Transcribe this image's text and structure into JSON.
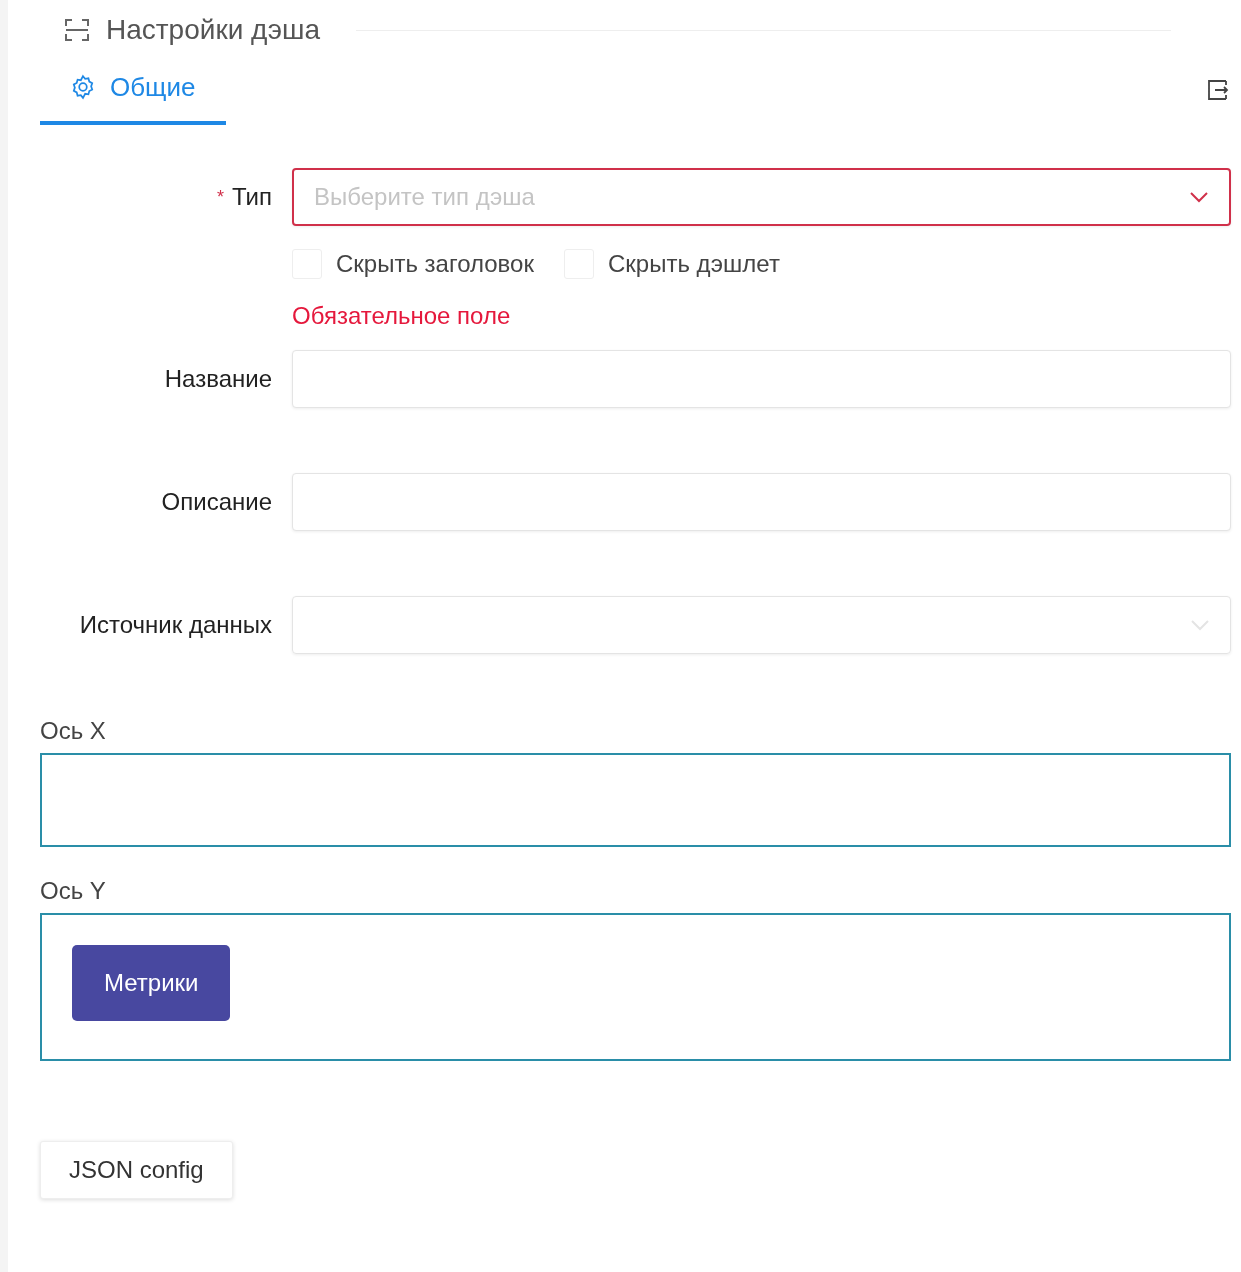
{
  "header": {
    "title": "Настройки дэша"
  },
  "tabs": [
    {
      "label": "Общие",
      "selected": true
    }
  ],
  "form": {
    "type_field": {
      "label": "Тип",
      "required_mark": "*",
      "placeholder": "Выберите тип дэша",
      "error": true
    },
    "checkboxes": [
      {
        "label": "Скрыть заголовок",
        "checked": false
      },
      {
        "label": "Скрыть дэшлет",
        "checked": false
      }
    ],
    "error_message": "Обязательное поле",
    "fields": [
      {
        "label": "Название",
        "kind": "input"
      },
      {
        "label": "Описание",
        "kind": "input"
      },
      {
        "label": "Источник данных",
        "kind": "select"
      }
    ]
  },
  "axes": [
    {
      "label": "Ось X"
    },
    {
      "label": "Ось Y",
      "buttons": [
        "Метрики"
      ]
    }
  ],
  "footer_button": "JSON config"
}
